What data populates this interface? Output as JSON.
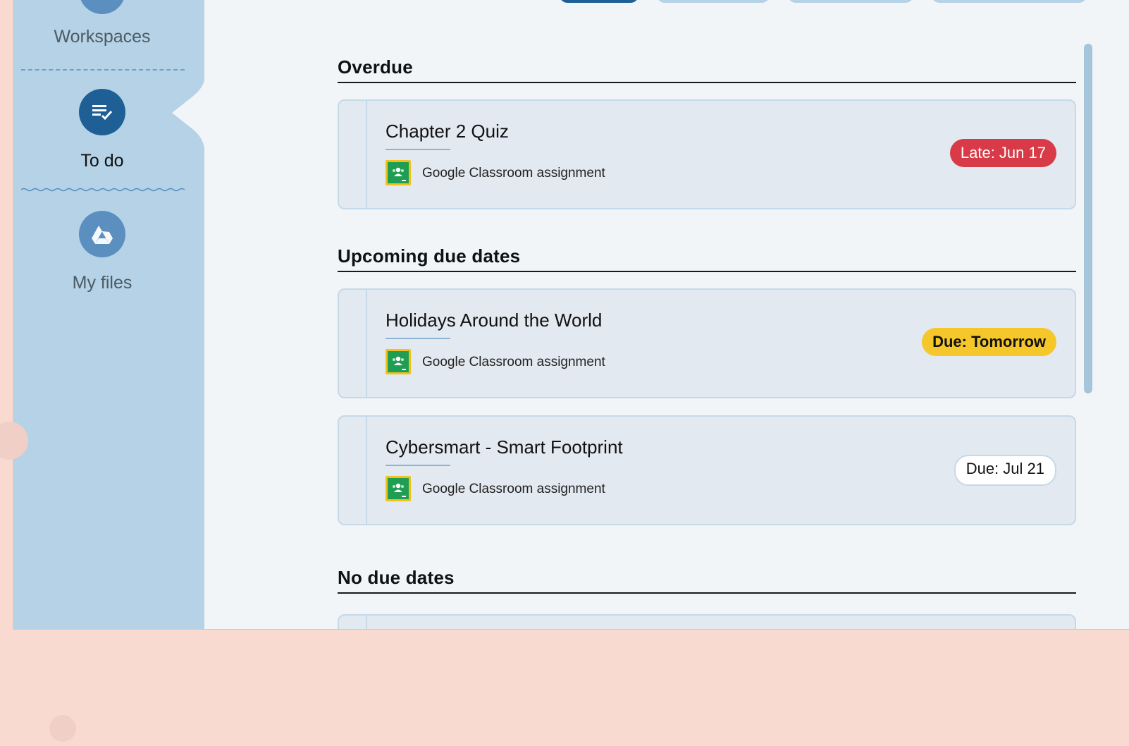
{
  "sidebar": {
    "items": [
      {
        "label": "Workspaces",
        "icon": "workspaces-icon"
      },
      {
        "label": "To do",
        "icon": "todo-checklist-icon",
        "active": true
      },
      {
        "label": "My files",
        "icon": "drive-icon"
      }
    ]
  },
  "main": {
    "sections": [
      {
        "heading": "Overdue",
        "items": [
          {
            "title": "Chapter 2 Quiz",
            "source": "Google Classroom assignment",
            "badge": "Late: Jun 17",
            "badge_color": "#d83a47"
          }
        ]
      },
      {
        "heading": "Upcoming due dates",
        "items": [
          {
            "title": "Holidays Around the World",
            "source": "Google Classroom assignment",
            "badge": "Due: Tomorrow",
            "badge_color": "#f5c72a"
          },
          {
            "title": "Cybersmart - Smart Footprint",
            "source": "Google Classroom assignment",
            "badge": "Due: Jul 21",
            "badge_color": "#ffffff"
          }
        ]
      },
      {
        "heading": "No due dates",
        "items": []
      }
    ]
  },
  "colors": {
    "sidebar_bg": "#b5d2e6",
    "active_nav": "#1e5f95",
    "inactive_nav": "#5b8fbf",
    "content_bg": "#f1f5f8",
    "outer_bg": "#f9dad1"
  }
}
